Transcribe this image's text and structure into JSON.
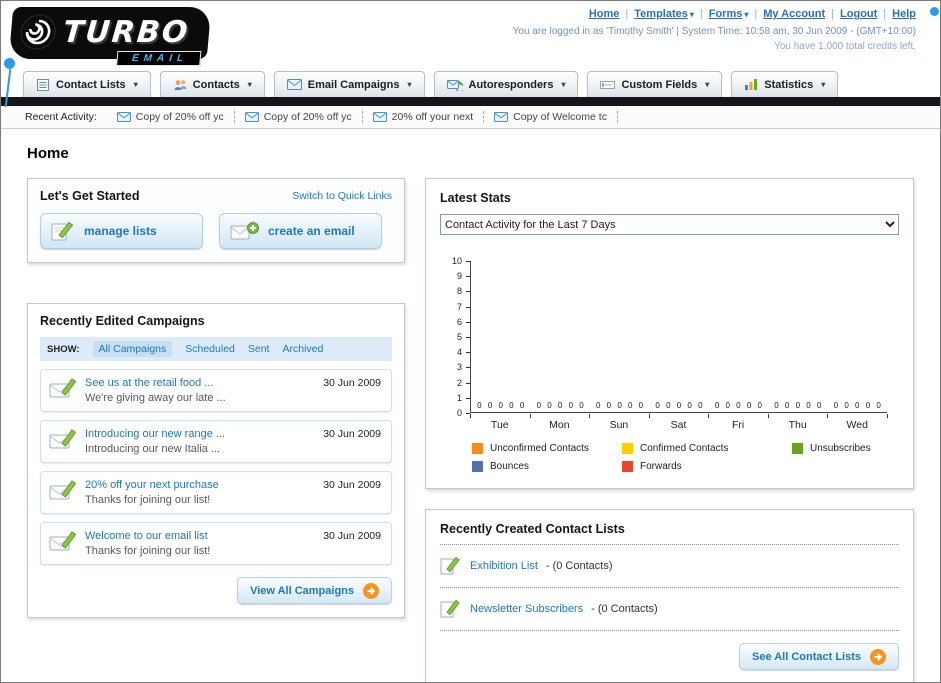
{
  "icons": {
    "dropdown": "▾"
  },
  "header": {
    "logo_text": "TURBO",
    "logo_sub": "EMAIL",
    "nav_links": [
      "Home",
      "Templates",
      "Forms",
      "My Account",
      "Logout",
      "Help"
    ],
    "login_info": "You are logged in as 'Timothy Smith' | System Time: 10:58 am, 30 Jun 2009 - (GMT+10:00)",
    "credits_info": "You have 1,000 total credits left."
  },
  "main_nav": {
    "tabs": [
      {
        "label": "Contact Lists"
      },
      {
        "label": "Contacts"
      },
      {
        "label": "Email Campaigns"
      },
      {
        "label": "Autoresponders"
      },
      {
        "label": "Custom Fields"
      },
      {
        "label": "Statistics"
      }
    ]
  },
  "recent_activity": {
    "label": "Recent Activity:",
    "items": [
      "Copy of 20% off yc",
      "Copy of 20% off yc",
      "20% off your next",
      "Copy of Welcome tc"
    ]
  },
  "page": {
    "title": "Home"
  },
  "get_started": {
    "title": "Let's Get Started",
    "switch_link": "Switch to Quick Links",
    "manage_lists_label": "manage lists",
    "create_email_label": "create an email"
  },
  "campaigns": {
    "title": "Recently Edited Campaigns",
    "show_label": "SHOW:",
    "filters": [
      "All Campaigns",
      "Scheduled",
      "Sent",
      "Archived"
    ],
    "items": [
      {
        "title": "See us at the retail food ...",
        "subtitle": "We're giving away our late ...",
        "date": "30 Jun 2009"
      },
      {
        "title": "Introducing our new range ...",
        "subtitle": "Introducing our new Italia ...",
        "date": "30 Jun 2009"
      },
      {
        "title": "20% off your next purchase",
        "subtitle": "Thanks for joining our list!",
        "date": "30 Jun 2009"
      },
      {
        "title": "Welcome to our email list",
        "subtitle": "Thanks for joining our list!",
        "date": "30 Jun 2009"
      }
    ],
    "view_all_label": "View All Campaigns"
  },
  "stats": {
    "title": "Latest Stats",
    "dropdown_value": "Contact Activity for the Last 7 Days",
    "chart_data": {
      "type": "bar",
      "title": "Contact Activity for the Last 7 Days",
      "categories": [
        "Tue",
        "Mon",
        "Sun",
        "Sat",
        "Fri",
        "Thu",
        "Wed"
      ],
      "series": [
        {
          "name": "Unconfirmed Contacts",
          "color": "#F68B1F",
          "values": [
            0,
            0,
            0,
            0,
            0,
            0,
            0
          ]
        },
        {
          "name": "Confirmed Contacts",
          "color": "#FFCE00",
          "values": [
            0,
            0,
            0,
            0,
            0,
            0,
            0
          ]
        },
        {
          "name": "Unsubscribes",
          "color": "#66A41E",
          "values": [
            0,
            0,
            0,
            0,
            0,
            0,
            0
          ]
        },
        {
          "name": "Bounces",
          "color": "#5571A6",
          "values": [
            0,
            0,
            0,
            0,
            0,
            0,
            0
          ]
        },
        {
          "name": "Forwards",
          "color": "#E8472B",
          "values": [
            0,
            0,
            0,
            0,
            0,
            0,
            0
          ]
        }
      ],
      "ylim": [
        0,
        10
      ],
      "grid": false,
      "legend_position": "bottom"
    }
  },
  "contact_lists": {
    "title": "Recently Created Contact Lists",
    "items": [
      {
        "name": "Exhibition List",
        "suffix": "- (0 Contacts)"
      },
      {
        "name": "Newsletter Subscribers",
        "suffix": "- (0 Contacts)"
      }
    ],
    "see_all_label": "See All Contact Lists"
  },
  "colors": {
    "accent_blue": "#1F78B8",
    "dark_bar": "#15151E",
    "orange_arrow": "#F7941D"
  }
}
